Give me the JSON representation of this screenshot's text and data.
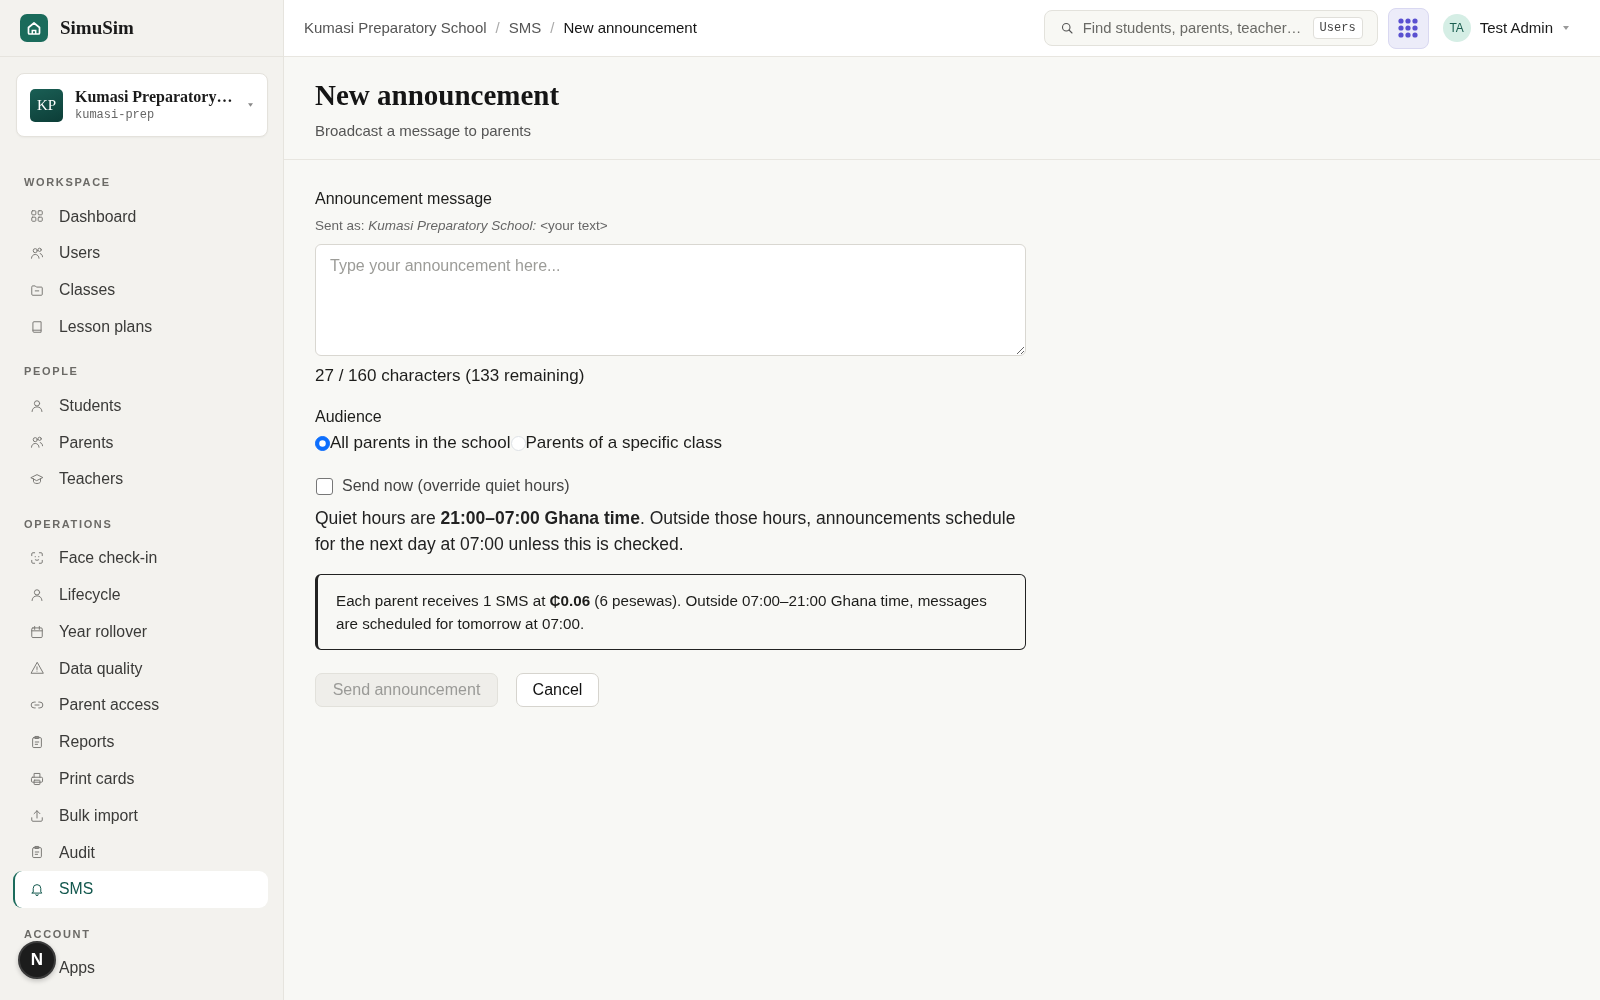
{
  "sidebar": {
    "brand": {
      "name": "SimuSim"
    },
    "school_switcher": {
      "initials": "KP",
      "name": "Kumasi Preparatory…",
      "slug": "kumasi-prep"
    },
    "sections": [
      {
        "title": "WORKSPACE",
        "items": [
          {
            "label": "Dashboard",
            "selected": false
          },
          {
            "label": "Users",
            "selected": false
          },
          {
            "label": "Classes",
            "selected": false
          },
          {
            "label": "Lesson plans",
            "selected": false
          }
        ]
      },
      {
        "title": "PEOPLE",
        "items": [
          {
            "label": "Students",
            "selected": false
          },
          {
            "label": "Parents",
            "selected": false
          },
          {
            "label": "Teachers",
            "selected": false
          }
        ]
      },
      {
        "title": "OPERATIONS",
        "items": [
          {
            "label": "Face check-in",
            "selected": false
          },
          {
            "label": "Lifecycle",
            "selected": false
          },
          {
            "label": "Year rollover",
            "selected": false
          },
          {
            "label": "Data quality",
            "selected": false
          },
          {
            "label": "Parent access",
            "selected": false
          },
          {
            "label": "Reports",
            "selected": false
          },
          {
            "label": "Print cards",
            "selected": false
          },
          {
            "label": "Bulk import",
            "selected": false
          },
          {
            "label": "Audit",
            "selected": false
          },
          {
            "label": "SMS",
            "selected": true
          }
        ]
      },
      {
        "title": "ACCOUNT",
        "items": [
          {
            "label": "Apps",
            "selected": false
          }
        ]
      }
    ]
  },
  "dev_indicator": {
    "label": "N"
  },
  "top_bar": {
    "breadcrumbs": [
      {
        "label": "Kumasi Preparatory School",
        "current": false,
        "separator": "/"
      },
      {
        "label": "SMS",
        "current": false,
        "separator": "/"
      },
      {
        "label": "New announcement",
        "current": true
      }
    ],
    "search": {
      "placeholder": "Find students, parents, teacher…",
      "scope": "Users"
    },
    "user": {
      "initials": "TA",
      "name": "Test Admin"
    }
  },
  "page": {
    "title": "New announcement",
    "subtitle": "Broadcast a message to parents"
  },
  "form": {
    "message": {
      "label": "Announcement message",
      "hint": "Sent as: *Kumasi Preparatory School:* <your text>",
      "placeholder": "Type your announcement here...",
      "counter": "27 / 160 characters (133 remaining)"
    },
    "audience": {
      "label": "Audience",
      "options": [
        {
          "label": "All parents in the school",
          "selected": true
        },
        {
          "label": "Parents of a specific class",
          "selected": false
        }
      ]
    },
    "send_now": {
      "label": "Send now (override quiet hours)",
      "checked": false
    },
    "quiet_hours_note": "Quiet hours are **21:00–07:00 Ghana time**. Outside those hours, announcements schedule for the next day at 07:00 unless this is checked.",
    "cost_notice": "Each parent receives 1 SMS at **₵0.06** (6 pesewas). Outside 07:00–21:00 Ghana time, messages are scheduled for tomorrow at 07:00.",
    "buttons": [
      {
        "label": "Send announcement",
        "kind": "primary",
        "disabled": true
      },
      {
        "label": "Cancel",
        "kind": "secondary",
        "disabled": false
      }
    ]
  }
}
